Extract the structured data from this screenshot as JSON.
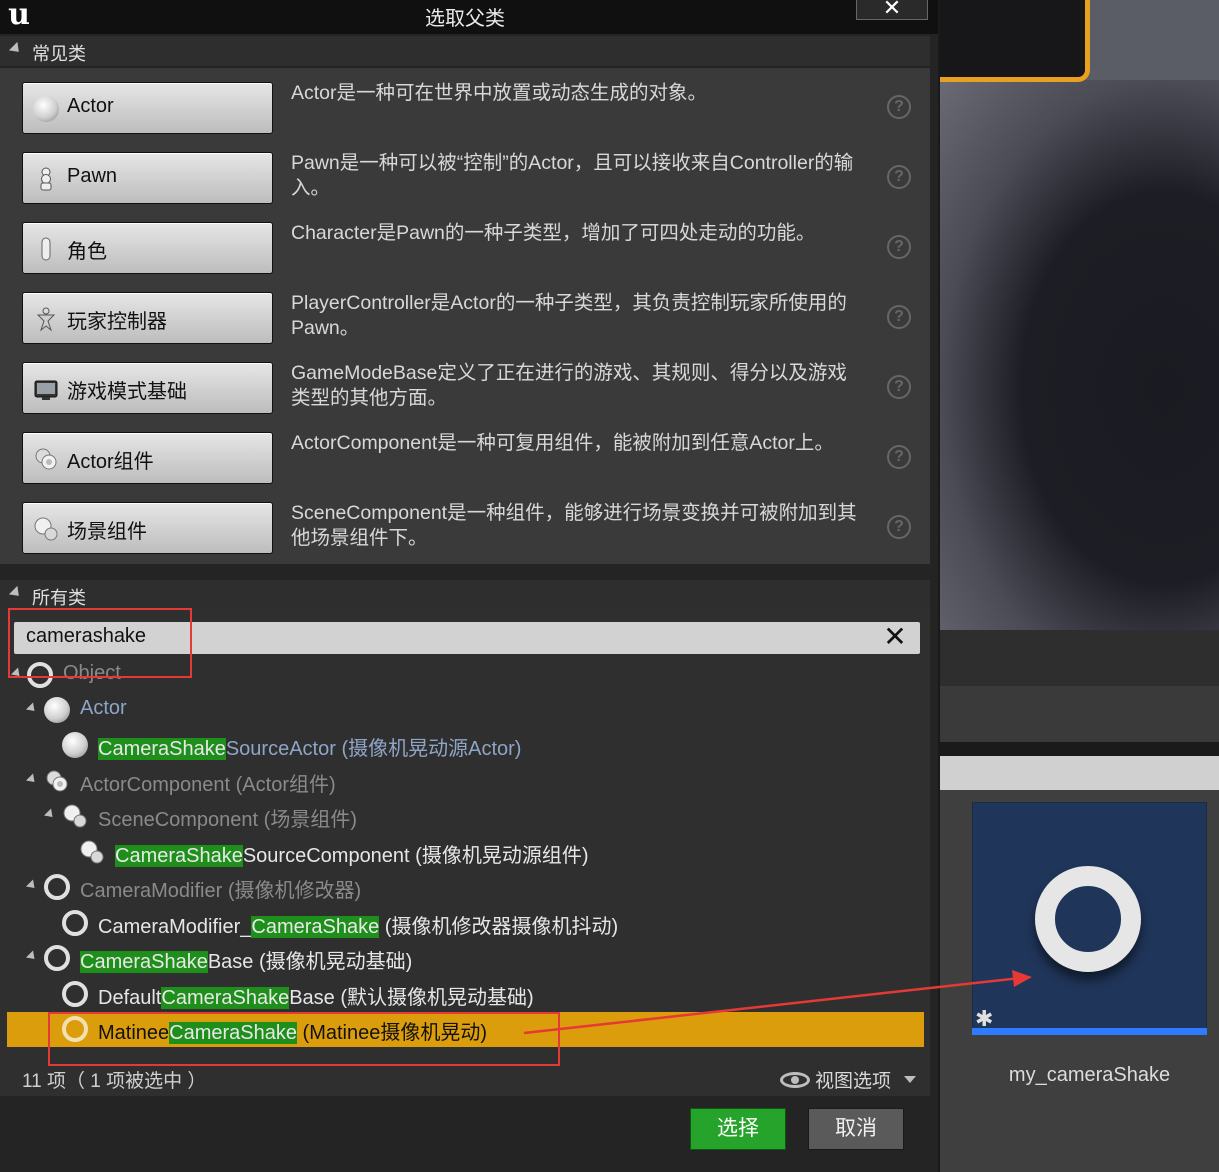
{
  "dialog": {
    "title": "选取父类",
    "logo": "u",
    "close_label": "✕"
  },
  "common": {
    "header": "常见类",
    "items": [
      {
        "label": "Actor",
        "desc": "Actor是一种可在世界中放置或动态生成的对象。",
        "icon": "actor-sphere-icon"
      },
      {
        "label": "Pawn",
        "desc": "Pawn是一种可以被“控制”的Actor，且可以接收来自Controller的输入。",
        "icon": "pawn-icon"
      },
      {
        "label": "角色",
        "desc": "Character是Pawn的一种子类型，增加了可四处走动的功能。",
        "icon": "character-capsule-icon"
      },
      {
        "label": "玩家控制器",
        "desc": "PlayerController是Actor的一种子类型，其负责控制玩家所使用的Pawn。",
        "icon": "player-controller-icon"
      },
      {
        "label": "游戏模式基础",
        "desc": "GameModeBase定义了正在进行的游戏、其规则、得分以及游戏类型的其他方面。",
        "icon": "game-mode-icon"
      },
      {
        "label": "Actor组件",
        "desc": "ActorComponent是一种可复用组件，能被附加到任意Actor上。",
        "icon": "actor-component-icon"
      },
      {
        "label": "场景组件",
        "desc": "SceneComponent是一种组件，能够进行场景变换并可被附加到其他场景组件下。",
        "icon": "scene-component-icon"
      }
    ],
    "help_glyph": "?"
  },
  "all": {
    "header": "所有类",
    "search_value": "camerashake",
    "clear_glyph": "✕",
    "tree": [
      {
        "pre": "Object",
        "hl": "",
        "post": ""
      },
      {
        "pre": "Actor",
        "hl": "",
        "post": ""
      },
      {
        "pre": "",
        "hl": "CameraShake",
        "post": "SourceActor (摄像机晃动源Actor)"
      },
      {
        "pre": "ActorComponent (Actor组件)",
        "hl": "",
        "post": ""
      },
      {
        "pre": "SceneComponent (场景组件)",
        "hl": "",
        "post": ""
      },
      {
        "pre": "",
        "hl": "CameraShake",
        "post": "SourceComponent (摄像机晃动源组件)"
      },
      {
        "pre": "CameraModifier (摄像机修改器)",
        "hl": "",
        "post": ""
      },
      {
        "pre": "CameraModifier_",
        "hl": "CameraShake",
        "post": " (摄像机修改器摄像机抖动)"
      },
      {
        "pre": "",
        "hl": "CameraShake",
        "post": "Base (摄像机晃动基础)"
      },
      {
        "pre": "Default",
        "hl": "CameraShake",
        "post": "Base (默认摄像机晃动基础)"
      },
      {
        "pre": "Matinee",
        "hl": "CameraShake",
        "post": " (Matinee摄像机晃动)"
      }
    ],
    "status": "11 项（ 1 项被选中 ）",
    "view_options": "视图选项"
  },
  "buttons": {
    "select": "选择",
    "cancel": "取消"
  },
  "asset": {
    "name": "my_cameraShake",
    "star": "✱"
  },
  "colors": {
    "highlight_green": "#1f8f1c",
    "selected_row": "#dc9d0c",
    "select_button": "#26a32a",
    "annotation_red": "#e53935",
    "asset_underline": "#2e7bff"
  }
}
